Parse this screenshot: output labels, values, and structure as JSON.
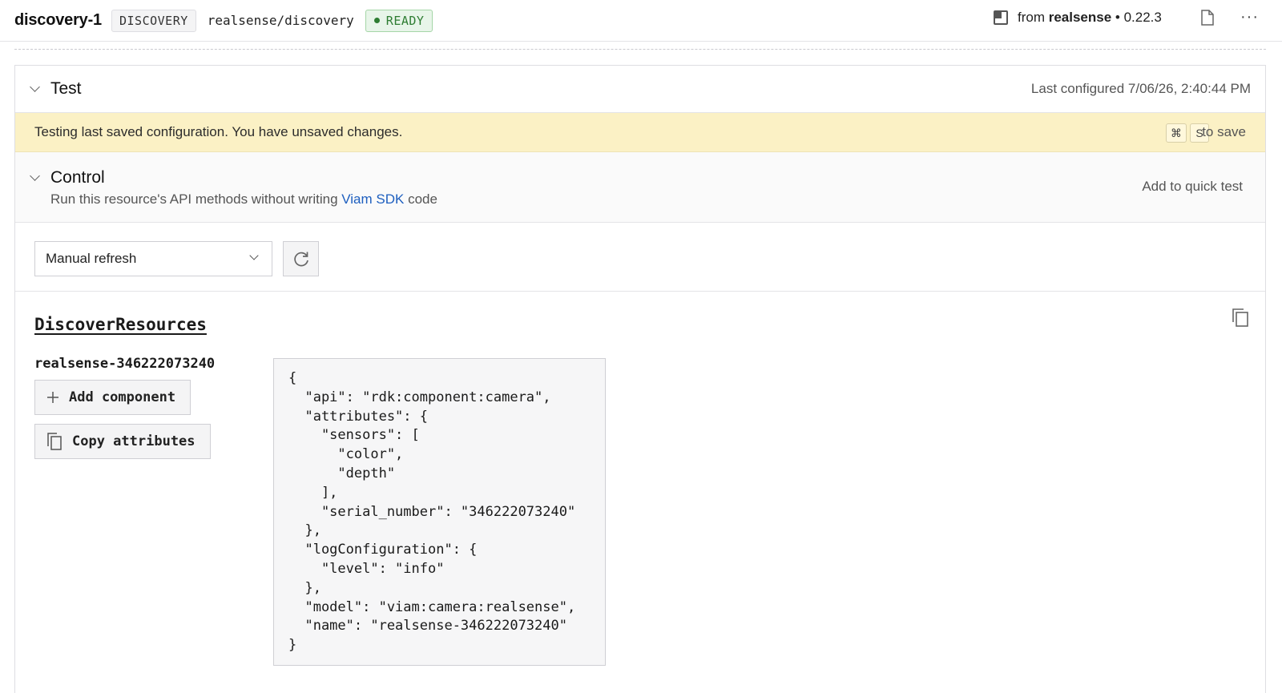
{
  "header": {
    "resource_name": "discovery-1",
    "type_chip": "DISCOVERY",
    "model": "realsense/discovery",
    "status": "READY",
    "from_prefix": "from ",
    "module_name": "realsense",
    "module_version": " • 0.22.3",
    "more_label": "···"
  },
  "test": {
    "title": "Test",
    "last_configured": "Last configured 7/06/26, 2:40:44 PM"
  },
  "banner": {
    "message": "Testing last saved configuration. You have unsaved changes.",
    "key_cmd": "⌘",
    "key_s": "S",
    "save_hint": "to save"
  },
  "control": {
    "title": "Control",
    "subtitle_prefix": "Run this resource's API methods without writing ",
    "subtitle_link": "Viam SDK",
    "subtitle_suffix": " code",
    "quick_test": "Add to quick test"
  },
  "refresh": {
    "selected": "Manual refresh"
  },
  "discover": {
    "method": "DiscoverResources",
    "resource_name": "realsense-346222073240",
    "add_component": "Add component",
    "copy_attributes": "Copy attributes",
    "json": "{\n  \"api\": \"rdk:component:camera\",\n  \"attributes\": {\n    \"sensors\": [\n      \"color\",\n      \"depth\"\n    ],\n    \"serial_number\": \"346222073240\"\n  },\n  \"logConfiguration\": {\n    \"level\": \"info\"\n  },\n  \"model\": \"viam:camera:realsense\",\n  \"name\": \"realsense-346222073240\"\n}"
  },
  "colors": {
    "ready_green": "#2e7d32",
    "banner_yellow": "#fbf1c5",
    "link_blue": "#1e5fbf"
  },
  "icons": [
    "module-icon",
    "document-icon",
    "more-icon",
    "chevron-down-icon",
    "refresh-icon",
    "copy-icon",
    "plus-icon"
  ]
}
